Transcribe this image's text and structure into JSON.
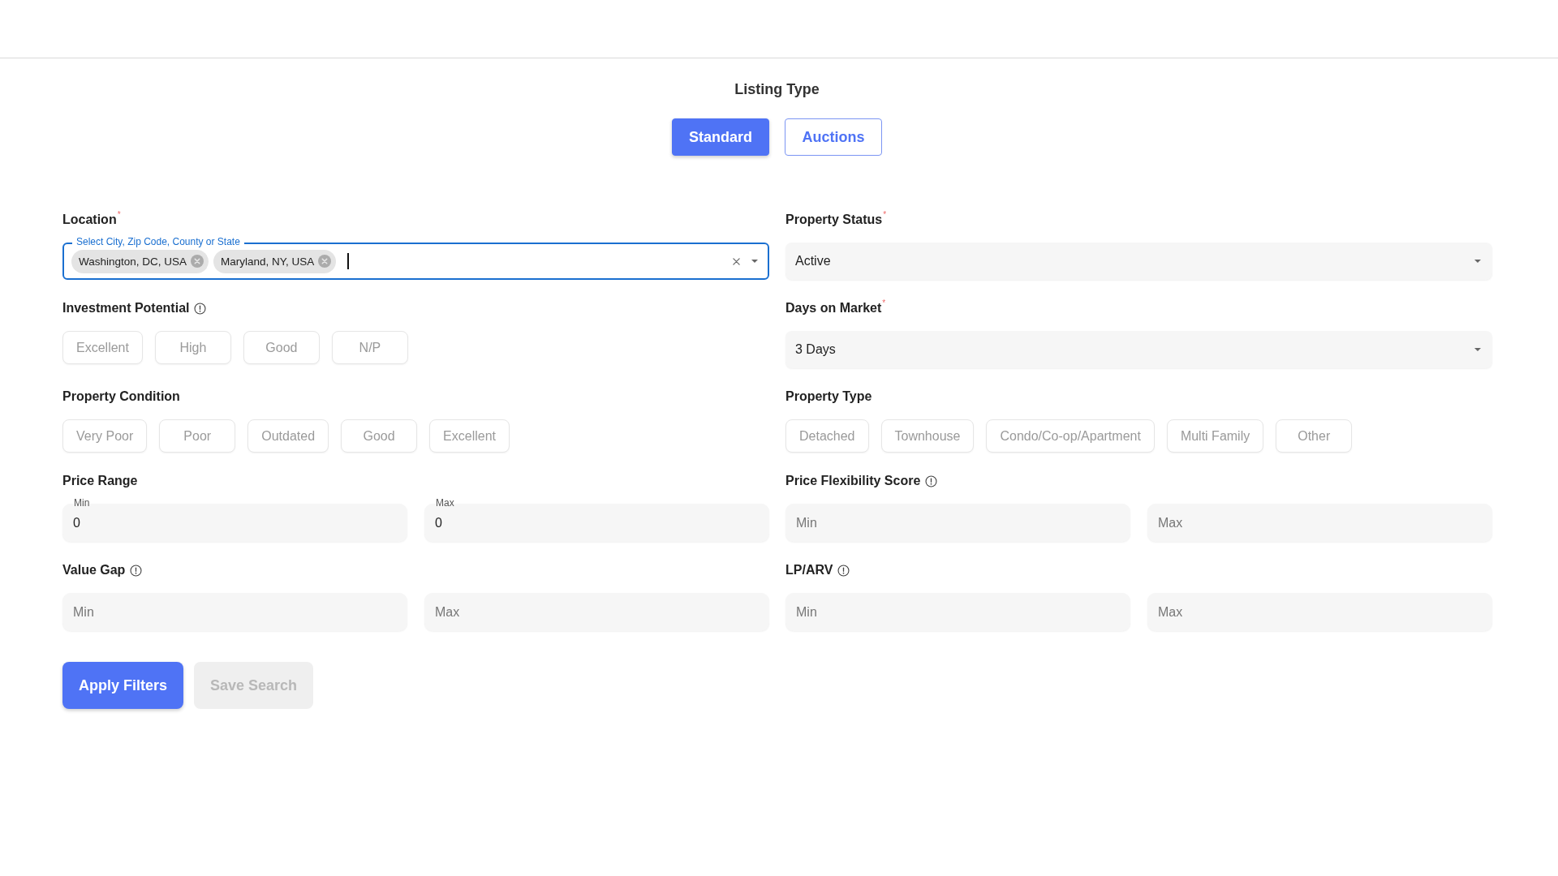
{
  "listing_type": {
    "title": "Listing Type",
    "options": [
      {
        "label": "Standard",
        "selected": true
      },
      {
        "label": "Auctions",
        "selected": false
      }
    ]
  },
  "filters": [
    {
      "kind": "location",
      "label": "Location",
      "required_mark": "*",
      "info": false,
      "floating_label": "Select City, Zip Code, County or State",
      "focused": true,
      "chips": [
        "Washington, DC, USA",
        "Maryland, NY, USA"
      ]
    },
    {
      "kind": "select",
      "label": "Property Status",
      "required_mark": "*",
      "info": false,
      "value": "Active"
    },
    {
      "kind": "options",
      "label": "Investment Potential",
      "info": true,
      "options": [
        {
          "label": "Excellent",
          "selected": false
        },
        {
          "label": "High",
          "selected": false
        },
        {
          "label": "Good",
          "selected": false
        },
        {
          "label": "N/P",
          "selected": false
        }
      ]
    },
    {
      "kind": "select",
      "label": "Days on Market",
      "required_mark": "*",
      "info": false,
      "value": "3 Days"
    },
    {
      "kind": "options",
      "label": "Property Condition",
      "info": false,
      "options": [
        {
          "label": "Very Poor",
          "selected": false
        },
        {
          "label": "Poor",
          "selected": false
        },
        {
          "label": "Outdated",
          "selected": false
        },
        {
          "label": "Good",
          "selected": false
        },
        {
          "label": "Excellent",
          "selected": false
        }
      ]
    },
    {
      "kind": "options",
      "label": "Property Type",
      "info": false,
      "options": [
        {
          "label": "Detached",
          "selected": false
        },
        {
          "label": "Townhouse",
          "selected": false
        },
        {
          "label": "Condo/Co-op/Apartment",
          "selected": false
        },
        {
          "label": "Multi Family",
          "selected": false
        },
        {
          "label": "Other",
          "selected": false
        }
      ]
    },
    {
      "kind": "range",
      "label": "Price Range",
      "info": false,
      "inputs": [
        {
          "label": "Min",
          "value": "0"
        },
        {
          "label": "Max",
          "value": "0"
        }
      ]
    },
    {
      "kind": "range",
      "label": "Price Flexibility Score",
      "info": true,
      "inputs": [
        {
          "placeholder": "Min"
        },
        {
          "placeholder": "Max"
        }
      ]
    },
    {
      "kind": "range",
      "label": "Value Gap",
      "info": true,
      "inputs": [
        {
          "placeholder": "Min"
        },
        {
          "placeholder": "Max"
        }
      ]
    },
    {
      "kind": "range",
      "label": "LP/ARV",
      "info": true,
      "inputs": [
        {
          "placeholder": "Min"
        },
        {
          "placeholder": "Max"
        }
      ]
    }
  ],
  "actions": [
    {
      "label": "Apply Filters",
      "disabled": false
    },
    {
      "label": "Save Search",
      "disabled": true
    }
  ]
}
